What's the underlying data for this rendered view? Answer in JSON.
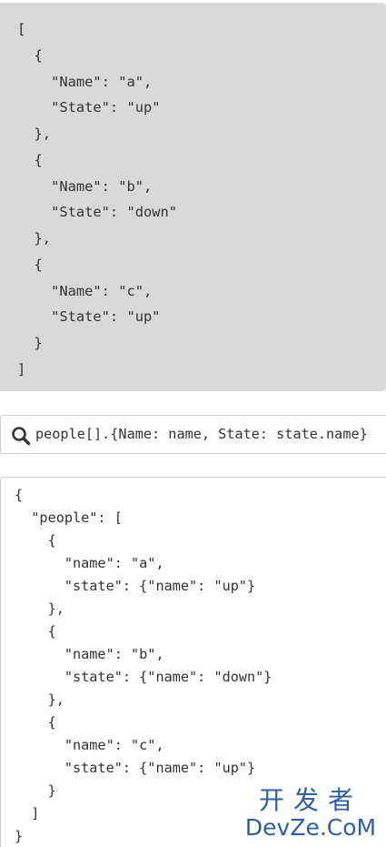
{
  "result": {
    "code": "[\n  {\n    \"Name\": \"a\",\n    \"State\": \"up\"\n  },\n  {\n    \"Name\": \"b\",\n    \"State\": \"down\"\n  },\n  {\n    \"Name\": \"c\",\n    \"State\": \"up\"\n  }\n]"
  },
  "search": {
    "icon": "search-icon",
    "value": "people[].{Name: name, State: state.name}"
  },
  "input": {
    "code": "{\n  \"people\": [\n    {\n      \"name\": \"a\",\n      \"state\": {\"name\": \"up\"}\n    },\n    {\n      \"name\": \"b\",\n      \"state\": {\"name\": \"down\"}\n    },\n    {\n      \"name\": \"c\",\n      \"state\": {\"name\": \"up\"}\n    }\n  ]\n}"
  },
  "watermark": {
    "top": "开发者",
    "bottom": "DevZe.CoM"
  },
  "colors": {
    "result_bg": "#d9d9d9",
    "text": "#333333",
    "border": "#cfcfcf",
    "watermark": "#2c5fa8"
  }
}
